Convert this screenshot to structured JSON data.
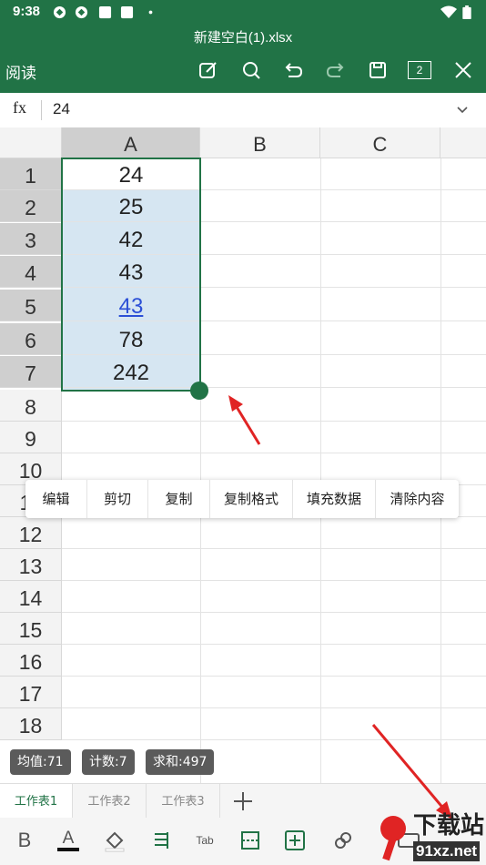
{
  "status_bar": {
    "time": "9:38"
  },
  "header": {
    "title": "新建空白(1).xlsx",
    "read_mode_label": "阅读",
    "window_count": "2"
  },
  "formula_bar": {
    "fx_label": "fx",
    "value": "24"
  },
  "grid": {
    "columns": [
      "A",
      "B",
      "C"
    ],
    "rows": [
      "1",
      "2",
      "3",
      "4",
      "5",
      "6",
      "7",
      "8",
      "9",
      "10",
      "11",
      "12",
      "13",
      "14",
      "15",
      "16",
      "17",
      "18"
    ],
    "column_a_values": [
      "24",
      "25",
      "42",
      "43",
      "43",
      "78",
      "242"
    ]
  },
  "context_menu": {
    "items": [
      "编辑",
      "剪切",
      "复制",
      "复制格式",
      "填充数据",
      "清除内容"
    ]
  },
  "stats": {
    "average": "均值:71",
    "count": "计数:7",
    "sum": "求和:497"
  },
  "sheet_tabs": [
    "工作表1",
    "工作表2",
    "工作表3"
  ],
  "bottom_toolbar": {
    "bold_label": "B",
    "font_color_label": "A",
    "tab_label": "Tab"
  },
  "watermark": {
    "brand": "下载站",
    "site": "91xz.net"
  },
  "colors": {
    "accent": "#217346",
    "selection_fill": "#d6e6f2",
    "link": "#2b4fd6",
    "annotation_arrow": "#e02424"
  }
}
